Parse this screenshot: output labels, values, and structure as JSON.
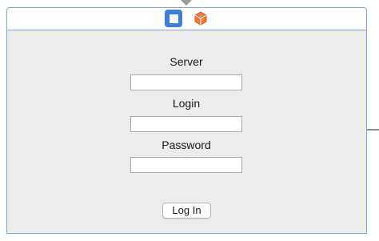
{
  "scene": {
    "toolbar_icons": [
      "view-controller-icon",
      "cube-icon"
    ],
    "accent_color": "#3d7fd6",
    "border_color": "#7ea6d6",
    "background_color": "#ececec"
  },
  "form": {
    "server_label": "Server",
    "server_value": "",
    "login_label": "Login",
    "login_value": "",
    "password_label": "Password",
    "password_value": "",
    "submit_label": "Log In"
  }
}
